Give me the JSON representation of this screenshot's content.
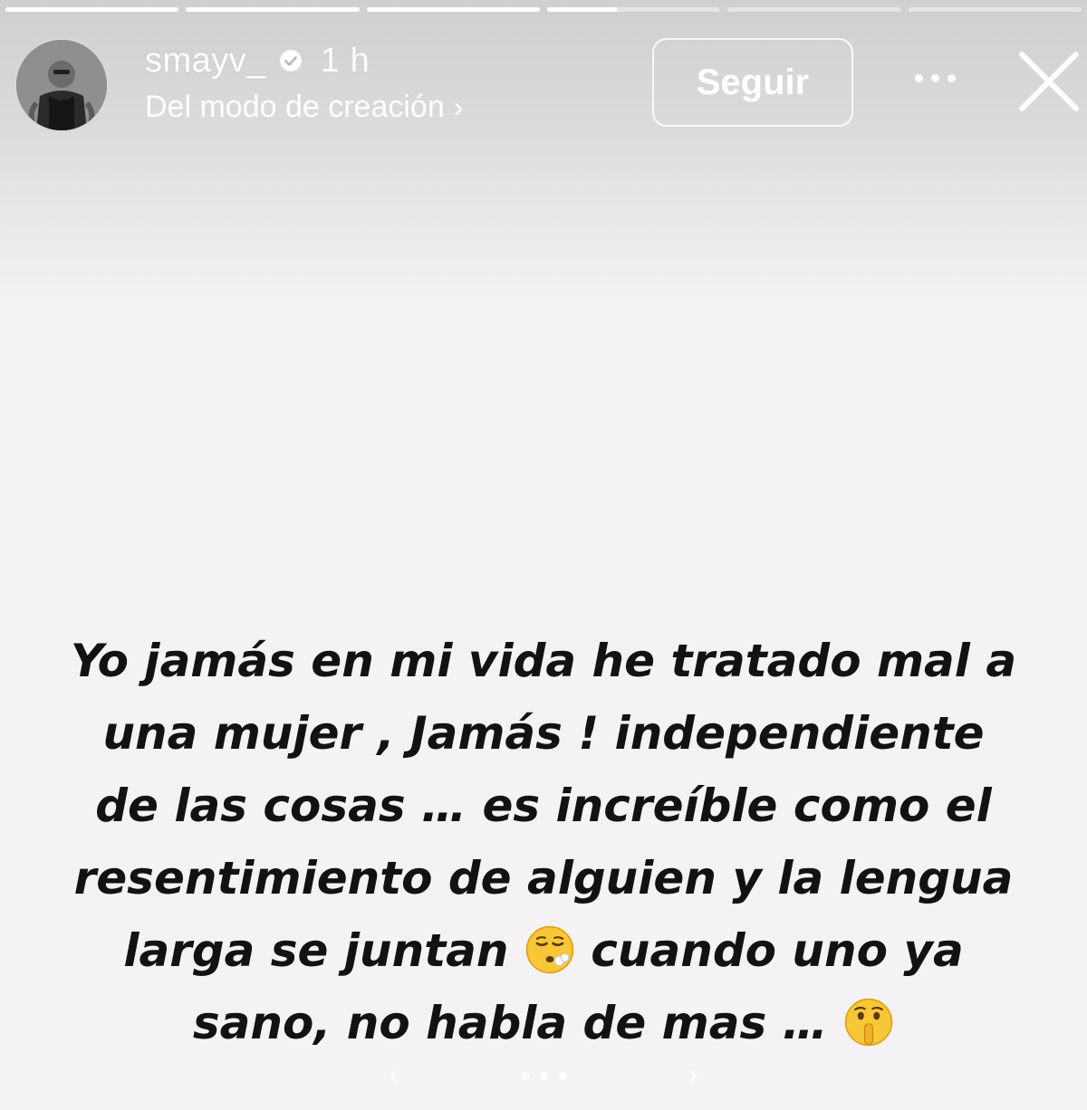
{
  "story": {
    "progress_segments": [
      1,
      1,
      1,
      0.4,
      0,
      0
    ],
    "background_color": "#f4f2f4",
    "text_color": "#121212"
  },
  "header": {
    "username": "smayv_",
    "time": "1 h",
    "subtitle": "Del modo de creación",
    "subtitle_chevron": "›",
    "follow_label": "Seguir",
    "more_icon": "more-horizontal-icon",
    "close_icon": "close-icon",
    "verified_icon": "verified-badge-icon"
  },
  "message": {
    "lines": [
      "Yo jamás en mi vida he tratado mal a",
      "una mujer , Jamás ! independiente",
      "de las cosas … es increíble como el",
      "resentimiento de alguien y la lengua"
    ],
    "line5_text_a": "larga se juntan",
    "line5_emoji": "exhaling-face",
    "line5_text_b": "cuando uno ya",
    "line6_text": "sano, no habla de mas …",
    "line6_emoji": "shushing-face"
  },
  "nav": {
    "prev": "‹",
    "next": "›",
    "pages": 3,
    "active_page": 3
  }
}
